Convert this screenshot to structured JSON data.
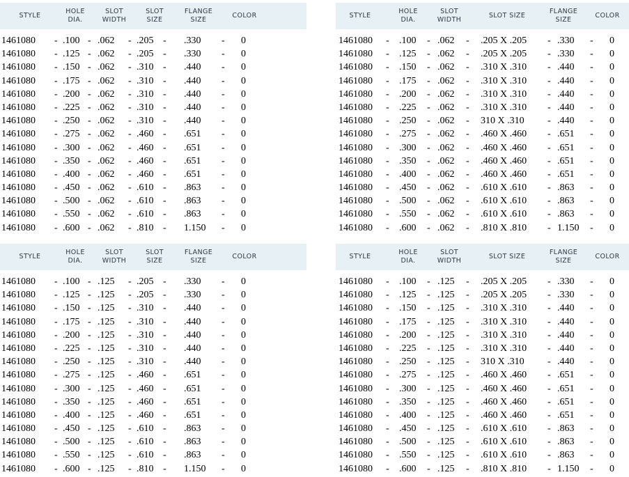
{
  "tables": [
    {
      "headers": [
        "STYLE",
        "HOLE\nDIA.",
        "SLOT\nWIDTH",
        "SLOT\nSIZE",
        "FLANGE\nSIZE",
        "COLOR"
      ],
      "rows": [
        [
          "1461080",
          ".100",
          ".062",
          ".205",
          ".330",
          "0"
        ],
        [
          "1461080",
          ".125",
          ".062",
          ".205",
          ".330",
          "0"
        ],
        [
          "1461080",
          ".150",
          ".062",
          ".310",
          ".440",
          "0"
        ],
        [
          "1461080",
          ".175",
          ".062",
          ".310",
          ".440",
          "0"
        ],
        [
          "1461080",
          ".200",
          ".062",
          ".310",
          ".440",
          "0"
        ],
        [
          "1461080",
          ".225",
          ".062",
          ".310",
          ".440",
          "0"
        ],
        [
          "1461080",
          ".250",
          ".062",
          ".310",
          ".440",
          "0"
        ],
        [
          "1461080",
          ".275",
          ".062",
          ".460",
          ".651",
          "0"
        ],
        [
          "1461080",
          ".300",
          ".062",
          ".460",
          ".651",
          "0"
        ],
        [
          "1461080",
          ".350",
          ".062",
          ".460",
          ".651",
          "0"
        ],
        [
          "1461080",
          ".400",
          ".062",
          ".460",
          ".651",
          "0"
        ],
        [
          "1461080",
          ".450",
          ".062",
          ".610",
          ".863",
          "0"
        ],
        [
          "1461080",
          ".500",
          ".062",
          ".610",
          ".863",
          "0"
        ],
        [
          "1461080",
          ".550",
          ".062",
          ".610",
          ".863",
          "0"
        ],
        [
          "1461080",
          ".600",
          ".062",
          ".810",
          "1.150",
          "0"
        ]
      ]
    },
    {
      "headers": [
        "STYLE",
        "HOLE\nDIA.",
        "SLOT\nWIDTH",
        "SLOT SIZE",
        "FLANGE\nSIZE",
        "COLOR"
      ],
      "rows": [
        [
          "1461080",
          ".100",
          ".062",
          ".205 X .205",
          ".330",
          "0"
        ],
        [
          "1461080",
          ".125",
          ".062",
          ".205 X .205",
          ".330",
          "0"
        ],
        [
          "1461080",
          ".150",
          ".062",
          ".310 X .310",
          ".440",
          "0"
        ],
        [
          "1461080",
          ".175",
          ".062",
          ".310 X .310",
          ".440",
          "0"
        ],
        [
          "1461080",
          ".200",
          ".062",
          ".310 X .310",
          ".440",
          "0"
        ],
        [
          "1461080",
          ".225",
          ".062",
          ".310 X .310",
          ".440",
          "0"
        ],
        [
          "1461080",
          ".250",
          ".062",
          "310 X .310",
          ".440",
          "0"
        ],
        [
          "1461080",
          ".275",
          ".062",
          ".460 X .460",
          ".651",
          "0"
        ],
        [
          "1461080",
          ".300",
          ".062",
          ".460 X .460",
          ".651",
          "0"
        ],
        [
          "1461080",
          ".350",
          ".062",
          ".460 X .460",
          ".651",
          "0"
        ],
        [
          "1461080",
          ".400",
          ".062",
          ".460 X .460",
          ".651",
          "0"
        ],
        [
          "1461080",
          ".450",
          ".062",
          ".610 X .610",
          ".863",
          "0"
        ],
        [
          "1461080",
          ".500",
          ".062",
          ".610 X .610",
          ".863",
          "0"
        ],
        [
          "1461080",
          ".550",
          ".062",
          ".610 X .610",
          ".863",
          "0"
        ],
        [
          "1461080",
          ".600",
          ".062",
          ".810 X .810",
          "1.150",
          "0"
        ]
      ]
    },
    {
      "headers": [
        "STYLE",
        "HOLE\nDIA.",
        "SLOT\nWIDTH",
        "SLOT\nSIZE",
        "FLANGE\nSIZE",
        "COLOR"
      ],
      "rows": [
        [
          "1461080",
          ".100",
          ".125",
          ".205",
          ".330",
          "0"
        ],
        [
          "1461080",
          ".125",
          ".125",
          ".205",
          ".330",
          "0"
        ],
        [
          "1461080",
          ".150",
          ".125",
          ".310",
          ".440",
          "0"
        ],
        [
          "1461080",
          ".175",
          ".125",
          ".310",
          ".440",
          "0"
        ],
        [
          "1461080",
          ".200",
          ".125",
          ".310",
          ".440",
          "0"
        ],
        [
          "1461080",
          ".225",
          ".125",
          ".310",
          ".440",
          "0"
        ],
        [
          "1461080",
          ".250",
          ".125",
          ".310",
          ".440",
          "0"
        ],
        [
          "1461080",
          ".275",
          ".125",
          ".460",
          ".651",
          "0"
        ],
        [
          "1461080",
          ".300",
          ".125",
          ".460",
          ".651",
          "0"
        ],
        [
          "1461080",
          ".350",
          ".125",
          ".460",
          ".651",
          "0"
        ],
        [
          "1461080",
          ".400",
          ".125",
          ".460",
          ".651",
          "0"
        ],
        [
          "1461080",
          ".450",
          ".125",
          ".610",
          ".863",
          "0"
        ],
        [
          "1461080",
          ".500",
          ".125",
          ".610",
          ".863",
          "0"
        ],
        [
          "1461080",
          ".550",
          ".125",
          ".610",
          ".863",
          "0"
        ],
        [
          "1461080",
          ".600",
          ".125",
          ".810",
          "1.150",
          "0"
        ]
      ]
    },
    {
      "headers": [
        "STYLE",
        "HOLE\nDIA.",
        "SLOT\nWIDTH",
        "SLOT SIZE",
        "FLANGE\nSIZE",
        "COLOR"
      ],
      "rows": [
        [
          "1461080",
          ".100",
          ".125",
          ".205 X .205",
          ".330",
          "0"
        ],
        [
          "1461080",
          ".125",
          ".125",
          ".205 X .205",
          ".330",
          "0"
        ],
        [
          "1461080",
          ".150",
          ".125",
          ".310 X .310",
          ".440",
          "0"
        ],
        [
          "1461080",
          ".175",
          ".125",
          ".310 X .310",
          ".440",
          "0"
        ],
        [
          "1461080",
          ".200",
          ".125",
          ".310 X .310",
          ".440",
          "0"
        ],
        [
          "1461080",
          ".225",
          ".125",
          ".310 X .310",
          ".440",
          "0"
        ],
        [
          "1461080",
          ".250",
          ".125",
          "310 X .310",
          ".440",
          "0"
        ],
        [
          "1461080",
          ".275",
          ".125",
          ".460 X .460",
          ".651",
          "0"
        ],
        [
          "1461080",
          ".300",
          ".125",
          ".460 X .460",
          ".651",
          "0"
        ],
        [
          "1461080",
          ".350",
          ".125",
          ".460 X .460",
          ".651",
          "0"
        ],
        [
          "1461080",
          ".400",
          ".125",
          ".460 X .460",
          ".651",
          "0"
        ],
        [
          "1461080",
          ".450",
          ".125",
          ".610 X .610",
          ".863",
          "0"
        ],
        [
          "1461080",
          ".500",
          ".125",
          ".610 X .610",
          ".863",
          "0"
        ],
        [
          "1461080",
          ".550",
          ".125",
          ".610 X .610",
          ".863",
          "0"
        ],
        [
          "1461080",
          ".600",
          ".125",
          ".810 X .810",
          "1.150",
          "0"
        ]
      ]
    }
  ],
  "separator": "-"
}
